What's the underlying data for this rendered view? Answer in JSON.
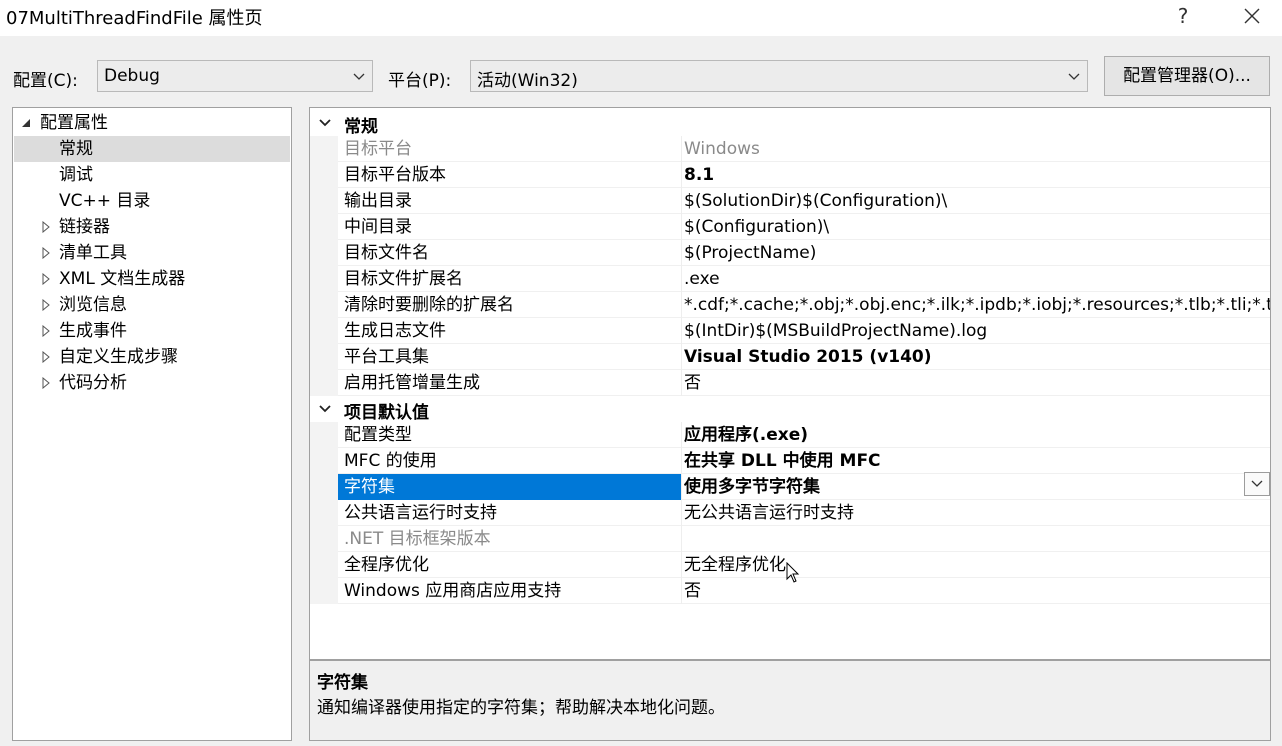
{
  "window": {
    "title": "07MultiThreadFindFile 属性页",
    "help_label": "?",
    "close_label": "✕"
  },
  "toolbar": {
    "config_label": "配置(C):",
    "config_value": "Debug",
    "platform_label": "平台(P):",
    "platform_value": "活动(Win32)",
    "manager_button": "配置管理器(O)..."
  },
  "tree": {
    "root": "配置属性",
    "items": [
      {
        "label": "常规",
        "expandable": false,
        "selected": true
      },
      {
        "label": "调试",
        "expandable": false,
        "selected": false
      },
      {
        "label": "VC++ 目录",
        "expandable": false,
        "selected": false
      },
      {
        "label": "链接器",
        "expandable": true,
        "selected": false
      },
      {
        "label": "清单工具",
        "expandable": true,
        "selected": false
      },
      {
        "label": "XML 文档生成器",
        "expandable": true,
        "selected": false
      },
      {
        "label": "浏览信息",
        "expandable": true,
        "selected": false
      },
      {
        "label": "生成事件",
        "expandable": true,
        "selected": false
      },
      {
        "label": "自定义生成步骤",
        "expandable": true,
        "selected": false
      },
      {
        "label": "代码分析",
        "expandable": true,
        "selected": false
      }
    ]
  },
  "grid": {
    "categories": [
      {
        "label": "常规",
        "rows": [
          {
            "name": "目标平台",
            "value": "Windows",
            "bold": false,
            "dim": true
          },
          {
            "name": "目标平台版本",
            "value": "8.1",
            "bold": true,
            "dim": false
          },
          {
            "name": "输出目录",
            "value": "$(SolutionDir)$(Configuration)\\",
            "bold": false,
            "dim": false
          },
          {
            "name": "中间目录",
            "value": "$(Configuration)\\",
            "bold": false,
            "dim": false
          },
          {
            "name": "目标文件名",
            "value": "$(ProjectName)",
            "bold": false,
            "dim": false
          },
          {
            "name": "目标文件扩展名",
            "value": ".exe",
            "bold": false,
            "dim": false
          },
          {
            "name": "清除时要删除的扩展名",
            "value": "*.cdf;*.cache;*.obj;*.obj.enc;*.ilk;*.ipdb;*.iobj;*.resources;*.tlb;*.tli;*.tlh;*",
            "bold": false,
            "dim": false
          },
          {
            "name": "生成日志文件",
            "value": "$(IntDir)$(MSBuildProjectName).log",
            "bold": false,
            "dim": false
          },
          {
            "name": "平台工具集",
            "value": "Visual Studio 2015 (v140)",
            "bold": true,
            "dim": false
          },
          {
            "name": "启用托管增量生成",
            "value": "否",
            "bold": false,
            "dim": false
          }
        ]
      },
      {
        "label": "项目默认值",
        "rows": [
          {
            "name": "配置类型",
            "value": "应用程序(.exe)",
            "bold": true,
            "dim": false
          },
          {
            "name": "MFC 的使用",
            "value": "在共享 DLL 中使用 MFC",
            "bold": true,
            "dim": false
          },
          {
            "name": "字符集",
            "value": "使用多字节字符集",
            "bold": true,
            "dim": false,
            "selected": true
          },
          {
            "name": "公共语言运行时支持",
            "value": "无公共语言运行时支持",
            "bold": false,
            "dim": false
          },
          {
            "name": ".NET 目标框架版本",
            "value": "",
            "bold": false,
            "dim": true
          },
          {
            "name": "全程序优化",
            "value": "无全程序优化",
            "bold": false,
            "dim": false
          },
          {
            "name": "Windows 应用商店应用支持",
            "value": "否",
            "bold": false,
            "dim": false
          }
        ]
      }
    ]
  },
  "description": {
    "title": "字符集",
    "text": "通知编译器使用指定的字符集；帮助解决本地化问题。"
  },
  "colors": {
    "selection": "#0078d7",
    "tree_selection": "#dcdcdc"
  }
}
